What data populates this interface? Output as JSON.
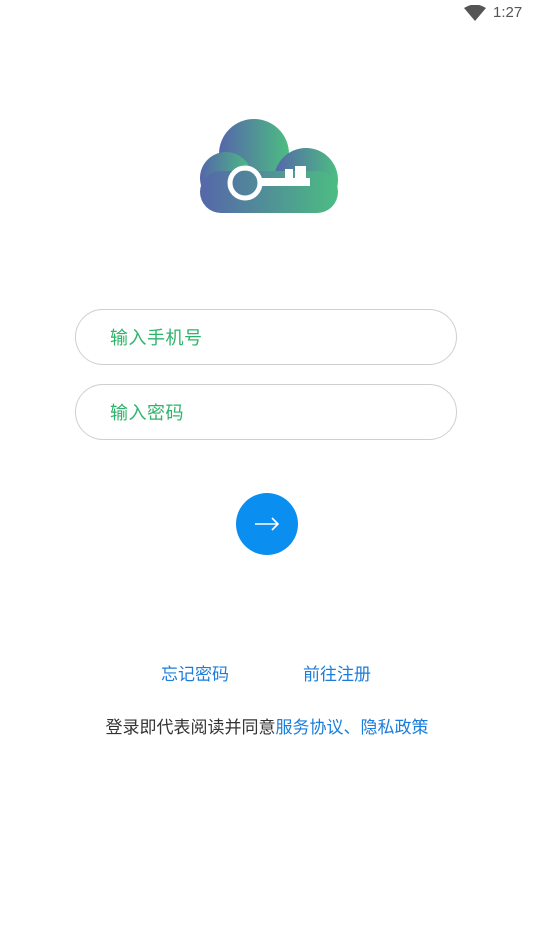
{
  "status_bar": {
    "time": "1:27",
    "wifi_icon": "wifi-icon"
  },
  "logo": {
    "icon": "cloud-key-logo",
    "gradient_start": "#5566aa",
    "gradient_end": "#4cbd82"
  },
  "form": {
    "phone_placeholder": "输入手机号",
    "password_placeholder": "输入密码",
    "submit_icon": "arrow-right-icon"
  },
  "links": {
    "forgot_password": "忘记密码",
    "register": "前往注册"
  },
  "agreement": {
    "prefix": "登录即代表阅读并同意",
    "service_terms": "服务协议",
    "separator": "、",
    "privacy_policy": "隐私政策"
  },
  "colors": {
    "accent_blue": "#0a8ff0",
    "link_blue": "#1a7ddb",
    "placeholder_green": "#2db36a"
  }
}
